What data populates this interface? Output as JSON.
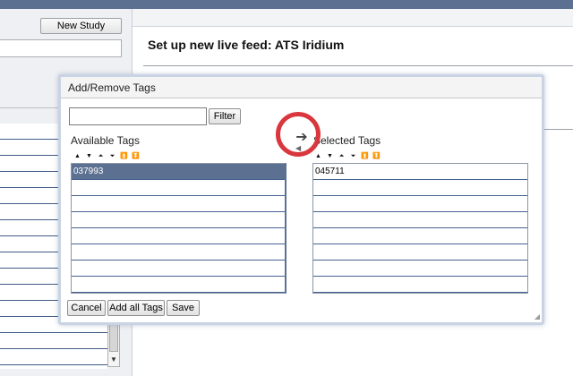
{
  "background": {
    "new_study_label": "New Study",
    "page_title": "Set up new live feed: ATS Iridium",
    "scroll_down_glyph": "▼"
  },
  "dialog": {
    "title": "Add/Remove Tags",
    "filter": {
      "value": "",
      "placeholder": "",
      "button_label": "Filter"
    },
    "available": {
      "label": "Available Tags",
      "items": [
        "037993",
        "",
        "",
        "",
        "",
        "",
        "",
        ""
      ],
      "selected_index": 0
    },
    "selected": {
      "label": "Selected Tags",
      "items": [
        "045711",
        "",
        "",
        "",
        "",
        "",
        "",
        ""
      ]
    },
    "ordering_controls": {
      "move_up": "▲",
      "move_down": "▼",
      "move_top": "⏶",
      "move_bottom": "⏷",
      "to_first": "⏫",
      "to_last": "⏬"
    },
    "move_right_glyph": "➔",
    "move_left_glyph": "◀",
    "buttons": {
      "cancel": "Cancel",
      "add_all": "Add all Tags",
      "save": "Save"
    }
  },
  "colors": {
    "header_bar": "#5c7191",
    "selection": "#5c7191",
    "highlight_ring": "#d9363e"
  },
  "icons": {
    "move_right": "arrow-right-icon",
    "highlight": "highlight-ring-icon"
  }
}
